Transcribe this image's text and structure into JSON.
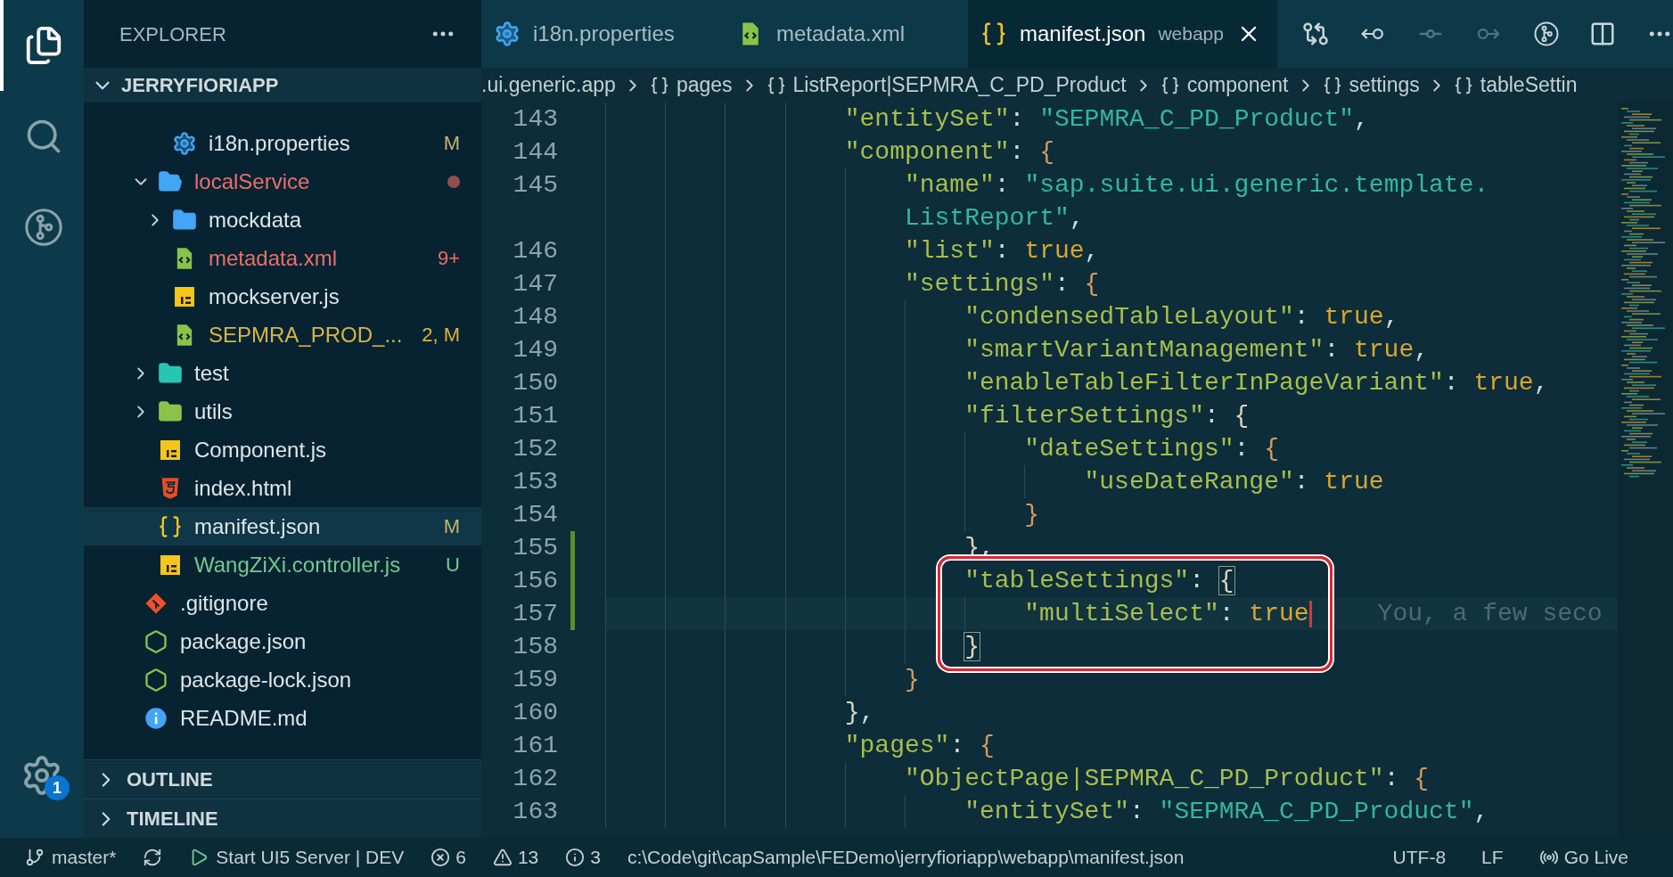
{
  "activity_bar": {
    "items": [
      {
        "kind": "files",
        "selected": true
      },
      {
        "kind": "search",
        "selected": false
      },
      {
        "kind": "graph",
        "selected": false
      }
    ],
    "bottom": {
      "kind": "settings",
      "badge": "1"
    }
  },
  "sidebar": {
    "title": "EXPLORER",
    "section": {
      "label": "JERRYFIORIAPP",
      "expanded": true
    },
    "tree": [
      {
        "kind": "hidden",
        "children": [
          {
            "kind": "hidden",
            "children": [
              {
                "kind": "gear",
                "label": "i18n.properties",
                "color": "#dfe6e9",
                "decoration": {
                  "kind": "text",
                  "text": "M",
                  "color": "#c9b46e"
                },
                "selected": false
              }
            ]
          },
          {
            "kind": "folder",
            "label": "localService",
            "expanded": true,
            "color": "#e8706a",
            "decoration": {
              "kind": "dot",
              "color": "#8e4f4d"
            },
            "selected": false,
            "children": [
              {
                "kind": "folder",
                "label": "mockdata",
                "expanded": false,
                "color": "#dfe6e9",
                "selected": false
              },
              {
                "kind": "xml",
                "label": "metadata.xml",
                "color": "#e8706a",
                "decoration": {
                  "kind": "text",
                  "text": "9+",
                  "color": "#e8706a"
                },
                "selected": false
              },
              {
                "kind": "js",
                "label": "mockserver.js",
                "color": "#dfe6e9",
                "selected": false
              },
              {
                "kind": "xml",
                "label": "SEPMRA_PROD_...",
                "color": "#d9b63f",
                "decoration": {
                  "kind": "text",
                  "text": "2, M",
                  "color": "#d9b63f"
                },
                "selected": false
              }
            ]
          },
          {
            "kind": "test-folder",
            "label": "test",
            "expanded": false,
            "color": "#dfe6e9",
            "selected": false
          },
          {
            "kind": "utils-folder",
            "label": "utils",
            "expanded": false,
            "color": "#dfe6e9",
            "selected": false
          },
          {
            "kind": "js",
            "label": "Component.js",
            "color": "#dfe6e9",
            "selected": false
          },
          {
            "kind": "html",
            "label": "index.html",
            "color": "#dfe6e9",
            "selected": false
          },
          {
            "kind": "json",
            "label": "manifest.json",
            "color": "#dfe6e9",
            "decoration": {
              "kind": "text",
              "text": "M",
              "color": "#c9b46e"
            },
            "selected": true
          },
          {
            "kind": "js",
            "label": "WangZiXi.controller.js",
            "color": "#73c991",
            "decoration": {
              "kind": "text",
              "text": "U",
              "color": "#73c991"
            },
            "selected": false
          }
        ]
      },
      {
        "kind": "git",
        "label": ".gitignore",
        "color": "#dfe6e9",
        "selected": false
      },
      {
        "kind": "node",
        "label": "package.json",
        "color": "#dfe6e9",
        "selected": false
      },
      {
        "kind": "node",
        "label": "package-lock.json",
        "color": "#dfe6e9",
        "selected": false
      },
      {
        "kind": "info",
        "label": "README.md",
        "color": "#dfe6e9",
        "selected": false
      }
    ],
    "panels": [
      {
        "label": "OUTLINE",
        "expanded": false
      },
      {
        "label": "TIMELINE",
        "expanded": false
      }
    ]
  },
  "tabs": [
    {
      "kind": "gear",
      "label": "i18n.properties",
      "selected": false,
      "close": false
    },
    {
      "kind": "xml",
      "label": "metadata.xml",
      "selected": false,
      "close": false
    },
    {
      "kind": "json",
      "label": "manifest.json",
      "description": "webapp",
      "selected": true,
      "close": true
    }
  ],
  "editor_actions": [
    {
      "kind": "compare",
      "disabled": false
    },
    {
      "kind": "previous",
      "disabled": false
    },
    {
      "kind": "commit",
      "disabled": true
    },
    {
      "kind": "next",
      "disabled": true
    },
    {
      "kind": "graph",
      "disabled": false
    },
    {
      "kind": "split",
      "disabled": false
    },
    {
      "kind": "more",
      "disabled": false
    }
  ],
  "breadcrumb": [
    {
      "kind": "text",
      "text": ".ui.generic.app"
    },
    {
      "kind": "object",
      "text": "pages"
    },
    {
      "kind": "object",
      "text": "ListReport|SEPMRA_C_PD_Product"
    },
    {
      "kind": "object",
      "text": "component"
    },
    {
      "kind": "object",
      "text": "settings"
    },
    {
      "kind": "object",
      "text": "tableSettin"
    }
  ],
  "code": {
    "lines": [
      {
        "kind": "hidden",
        "children": [
          {
            "kind": "hidden",
            "children": [
              {
                "kind": "hidden",
                "children": [
                  {
                    "kind": "hidden",
                    "children": [
                      {
                        "number": "143",
                        "changed": false,
                        "current": false,
                        "framed": false,
                        "cursor": false,
                        "tokens": [
                          {
                            "kind": "key",
                            "text": "\"entitySet\""
                          },
                          {
                            "kind": "punct",
                            "text": ": "
                          },
                          {
                            "kind": "string",
                            "text": "\"SEPMRA_C_PD_Product\""
                          },
                          {
                            "kind": "punct",
                            "text": ","
                          }
                        ]
                      },
                      {
                        "number": "144",
                        "changed": false,
                        "current": false,
                        "framed": false,
                        "cursor": false,
                        "tokens": [
                          {
                            "kind": "key",
                            "text": "\"component\""
                          },
                          {
                            "kind": "punct",
                            "text": ": "
                          },
                          {
                            "kind": "brace_a",
                            "text": "{"
                          }
                        ],
                        "children": [
                          {
                            "number": "145",
                            "changed": false,
                            "current": false,
                            "framed": false,
                            "cursor": false,
                            "tokens": [
                              {
                                "kind": "key",
                                "text": "\"name\""
                              },
                              {
                                "kind": "punct",
                                "text": ": "
                              },
                              {
                                "kind": "string",
                                "text": "\"sap.suite.ui.generic.template."
                              }
                            ],
                            "wrap": [
                              {
                                "kind": "string",
                                "text": "ListReport\""
                              },
                              {
                                "kind": "punct",
                                "text": ","
                              }
                            ]
                          },
                          {
                            "number": "146",
                            "changed": false,
                            "current": false,
                            "framed": false,
                            "cursor": false,
                            "tokens": [
                              {
                                "kind": "key",
                                "text": "\"list\""
                              },
                              {
                                "kind": "punct",
                                "text": ": "
                              },
                              {
                                "kind": "bool",
                                "text": "true"
                              },
                              {
                                "kind": "punct",
                                "text": ","
                              }
                            ]
                          },
                          {
                            "number": "147",
                            "changed": false,
                            "current": false,
                            "framed": false,
                            "cursor": false,
                            "tokens": [
                              {
                                "kind": "key",
                                "text": "\"settings\""
                              },
                              {
                                "kind": "punct",
                                "text": ": "
                              },
                              {
                                "kind": "brace_a",
                                "text": "{"
                              }
                            ],
                            "children": [
                              {
                                "number": "148",
                                "changed": false,
                                "current": false,
                                "framed": false,
                                "cursor": false,
                                "tokens": [
                                  {
                                    "kind": "key",
                                    "text": "\"condensedTableLayout\""
                                  },
                                  {
                                    "kind": "punct",
                                    "text": ": "
                                  },
                                  {
                                    "kind": "bool",
                                    "text": "true"
                                  },
                                  {
                                    "kind": "punct",
                                    "text": ","
                                  }
                                ]
                              },
                              {
                                "number": "149",
                                "changed": false,
                                "current": false,
                                "framed": false,
                                "cursor": false,
                                "tokens": [
                                  {
                                    "kind": "key",
                                    "text": "\"smartVariantManagement\""
                                  },
                                  {
                                    "kind": "punct",
                                    "text": ": "
                                  },
                                  {
                                    "kind": "bool",
                                    "text": "true"
                                  },
                                  {
                                    "kind": "punct",
                                    "text": ","
                                  }
                                ]
                              },
                              {
                                "number": "150",
                                "changed": false,
                                "current": false,
                                "framed": false,
                                "cursor": false,
                                "tokens": [
                                  {
                                    "kind": "key",
                                    "text": "\"enableTableFilterInPageVariant\""
                                  },
                                  {
                                    "kind": "punct",
                                    "text": ": "
                                  },
                                  {
                                    "kind": "bool",
                                    "text": "true"
                                  },
                                  {
                                    "kind": "punct",
                                    "text": ","
                                  }
                                ]
                              },
                              {
                                "number": "151",
                                "changed": false,
                                "current": false,
                                "framed": false,
                                "cursor": false,
                                "tokens": [
                                  {
                                    "kind": "key",
                                    "text": "\"filterSettings\""
                                  },
                                  {
                                    "kind": "punct",
                                    "text": ": "
                                  },
                                  {
                                    "kind": "brace_b",
                                    "text": "{"
                                  }
                                ],
                                "children": [
                                  {
                                    "number": "152",
                                    "changed": false,
                                    "current": false,
                                    "framed": false,
                                    "cursor": false,
                                    "tokens": [
                                      {
                                        "kind": "key",
                                        "text": "\"dateSettings\""
                                      },
                                      {
                                        "kind": "punct",
                                        "text": ": "
                                      },
                                      {
                                        "kind": "brace_a",
                                        "text": "{"
                                      }
                                    ],
                                    "children": [
                                      {
                                        "number": "153",
                                        "changed": false,
                                        "current": false,
                                        "framed": false,
                                        "cursor": false,
                                        "tokens": [
                                          {
                                            "kind": "key",
                                            "text": "\"useDateRange\""
                                          },
                                          {
                                            "kind": "punct",
                                            "text": ": "
                                          },
                                          {
                                            "kind": "bool",
                                            "text": "true"
                                          }
                                        ]
                                      }
                                    ]
                                  },
                                  {
                                    "number": "154",
                                    "changed": false,
                                    "current": false,
                                    "framed": false,
                                    "cursor": false,
                                    "tokens": [
                                      {
                                        "kind": "brace_a",
                                        "text": "}"
                                      }
                                    ]
                                  }
                                ]
                              },
                              {
                                "number": "155",
                                "changed": true,
                                "current": false,
                                "framed": false,
                                "cursor": false,
                                "tokens": [
                                  {
                                    "kind": "brace_b",
                                    "text": "}"
                                  },
                                  {
                                    "kind": "punct",
                                    "text": ","
                                  }
                                ]
                              },
                              {
                                "number": "156",
                                "changed": true,
                                "current": false,
                                "framed": true,
                                "cursor": false,
                                "tokens": [
                                  {
                                    "kind": "key",
                                    "text": "\"tableSettings\""
                                  },
                                  {
                                    "kind": "punct",
                                    "text": ": "
                                  },
                                  {
                                    "kind": "brace_match",
                                    "text": "{"
                                  }
                                ],
                                "children": [
                                  {
                                    "number": "157",
                                    "changed": true,
                                    "current": true,
                                    "framed": true,
                                    "cursor": true,
                                    "ghost": "You, a few seco",
                                    "tokens": [
                                      {
                                        "kind": "key",
                                        "text": "\"multiSelect\""
                                      },
                                      {
                                        "kind": "punct",
                                        "text": ": "
                                      },
                                      {
                                        "kind": "bool",
                                        "text": "true"
                                      }
                                    ]
                                  }
                                ]
                              },
                              {
                                "number": "158",
                                "changed": false,
                                "current": false,
                                "framed": true,
                                "cursor": false,
                                "tokens": [
                                  {
                                    "kind": "brace_match",
                                    "text": "}"
                                  }
                                ]
                              }
                            ]
                          },
                          {
                            "number": "159",
                            "changed": false,
                            "current": false,
                            "framed": false,
                            "cursor": false,
                            "tokens": [
                              {
                                "kind": "brace_a",
                                "text": "}"
                              }
                            ]
                          }
                        ]
                      },
                      {
                        "number": "160",
                        "changed": false,
                        "current": false,
                        "framed": false,
                        "cursor": false,
                        "tokens": [
                          {
                            "kind": "brace_b",
                            "text": "}"
                          },
                          {
                            "kind": "punct",
                            "text": ","
                          }
                        ]
                      },
                      {
                        "number": "161",
                        "changed": false,
                        "current": false,
                        "framed": false,
                        "cursor": false,
                        "tokens": [
                          {
                            "kind": "key",
                            "text": "\"pages\""
                          },
                          {
                            "kind": "punct",
                            "text": ": "
                          },
                          {
                            "kind": "brace_a",
                            "text": "{"
                          }
                        ],
                        "children": [
                          {
                            "number": "162",
                            "changed": false,
                            "current": false,
                            "framed": false,
                            "cursor": false,
                            "tokens": [
                              {
                                "kind": "key",
                                "text": "\"ObjectPage|SEPMRA_C_PD_Product\""
                              },
                              {
                                "kind": "punct",
                                "text": ": "
                              },
                              {
                                "kind": "brace_a",
                                "text": "{"
                              }
                            ],
                            "children": [
                              {
                                "number": "163",
                                "changed": false,
                                "current": false,
                                "framed": false,
                                "cursor": false,
                                "tokens": [
                                  {
                                    "kind": "key",
                                    "text": "\"entitySet\""
                                  },
                                  {
                                    "kind": "punct",
                                    "text": ": "
                                  },
                                  {
                                    "kind": "string",
                                    "text": "\"SEPMRA_C_PD_Product\""
                                  },
                                  {
                                    "kind": "punct",
                                    "text": ","
                                  }
                                ]
                              }
                            ]
                          }
                        ]
                      }
                    ]
                  }
                ]
              }
            ]
          }
        ]
      }
    ]
  },
  "status_bar": {
    "left": [
      {
        "kind": "branch",
        "text": "master*"
      },
      {
        "kind": "sync"
      },
      {
        "kind": "run",
        "text": "Start UI5 Server | DEV"
      },
      {
        "kind": "errors",
        "text": "6"
      },
      {
        "kind": "warnings",
        "text": "13"
      },
      {
        "kind": "infos",
        "text": "3"
      },
      {
        "kind": "text",
        "text": "c:\\Code\\git\\capSample\\FEDemo\\jerryfioriapp\\webapp\\manifest.json"
      }
    ],
    "right": [
      {
        "kind": "text",
        "text": "UTF-8"
      },
      {
        "kind": "text",
        "text": "LF"
      },
      {
        "kind": "live",
        "text": "Go Live"
      }
    ]
  }
}
